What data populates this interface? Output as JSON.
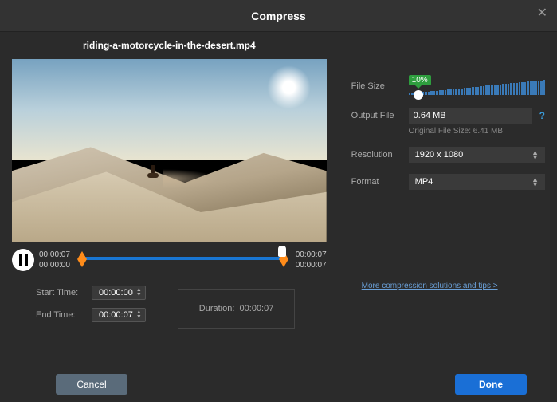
{
  "titlebar": {
    "title": "Compress"
  },
  "filename": "riding-a-motorcycle-in-the-desert.mp4",
  "timeline": {
    "current": "00:00:07",
    "start": "00:00:00",
    "end_current": "00:00:07",
    "end_total": "00:00:07"
  },
  "startTime": {
    "label": "Start Time:",
    "value": "00:00:00"
  },
  "endTime": {
    "label": "End Time:",
    "value": "00:00:07"
  },
  "duration": {
    "label": "Duration:",
    "value": "00:00:07"
  },
  "fileSize": {
    "label": "File Size",
    "percent": "10%"
  },
  "outputFile": {
    "label": "Output File",
    "value": "0.64 MB"
  },
  "originalSize": "Original File Size: 6.41 MB",
  "resolution": {
    "label": "Resolution",
    "value": "1920 x 1080"
  },
  "format": {
    "label": "Format",
    "value": "MP4"
  },
  "moreLink": "More compression solutions and tips >",
  "buttons": {
    "cancel": "Cancel",
    "done": "Done"
  }
}
